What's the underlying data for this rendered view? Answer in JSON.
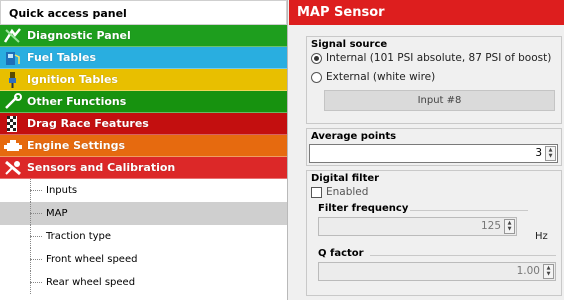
{
  "quick_access": {
    "title": "Quick access panel",
    "categories": [
      {
        "label": "Diagnostic Panel",
        "color": "#1e9e1e",
        "icon": "diagnostic-icon"
      },
      {
        "label": "Fuel Tables",
        "color": "#29aee0",
        "icon": "fuel-icon"
      },
      {
        "label": "Ignition Tables",
        "color": "#e8bf00",
        "icon": "ignition-icon"
      },
      {
        "label": "Other Functions",
        "color": "#17920f",
        "icon": "functions-icon"
      },
      {
        "label": "Drag Race Features",
        "color": "#c30f0f",
        "icon": "drag-race-icon"
      },
      {
        "label": "Engine Settings",
        "color": "#e66a0f",
        "icon": "engine-icon"
      },
      {
        "label": "Sensors and Calibration",
        "color": "#dc2828",
        "icon": "sensors-icon"
      }
    ],
    "sensor_items": [
      "Inputs",
      "MAP",
      "Traction type",
      "Front wheel speed",
      "Rear wheel speed"
    ],
    "selected_item": "MAP"
  },
  "panel": {
    "title": "MAP Sensor",
    "signal_source": {
      "title": "Signal source",
      "internal": "Internal (101 PSI absolute, 87 PSI of boost)",
      "external": "External (white wire)",
      "input_button": "Input #8",
      "selected": "internal"
    },
    "average_points": {
      "title": "Average points",
      "value": "3"
    },
    "digital_filter": {
      "title": "Digital filter",
      "enabled_label": "Enabled",
      "enabled": false,
      "frequency_label": "Filter frequency",
      "frequency_value": "125",
      "frequency_unit": "Hz",
      "q_label": "Q factor",
      "q_value": "1.00"
    }
  }
}
